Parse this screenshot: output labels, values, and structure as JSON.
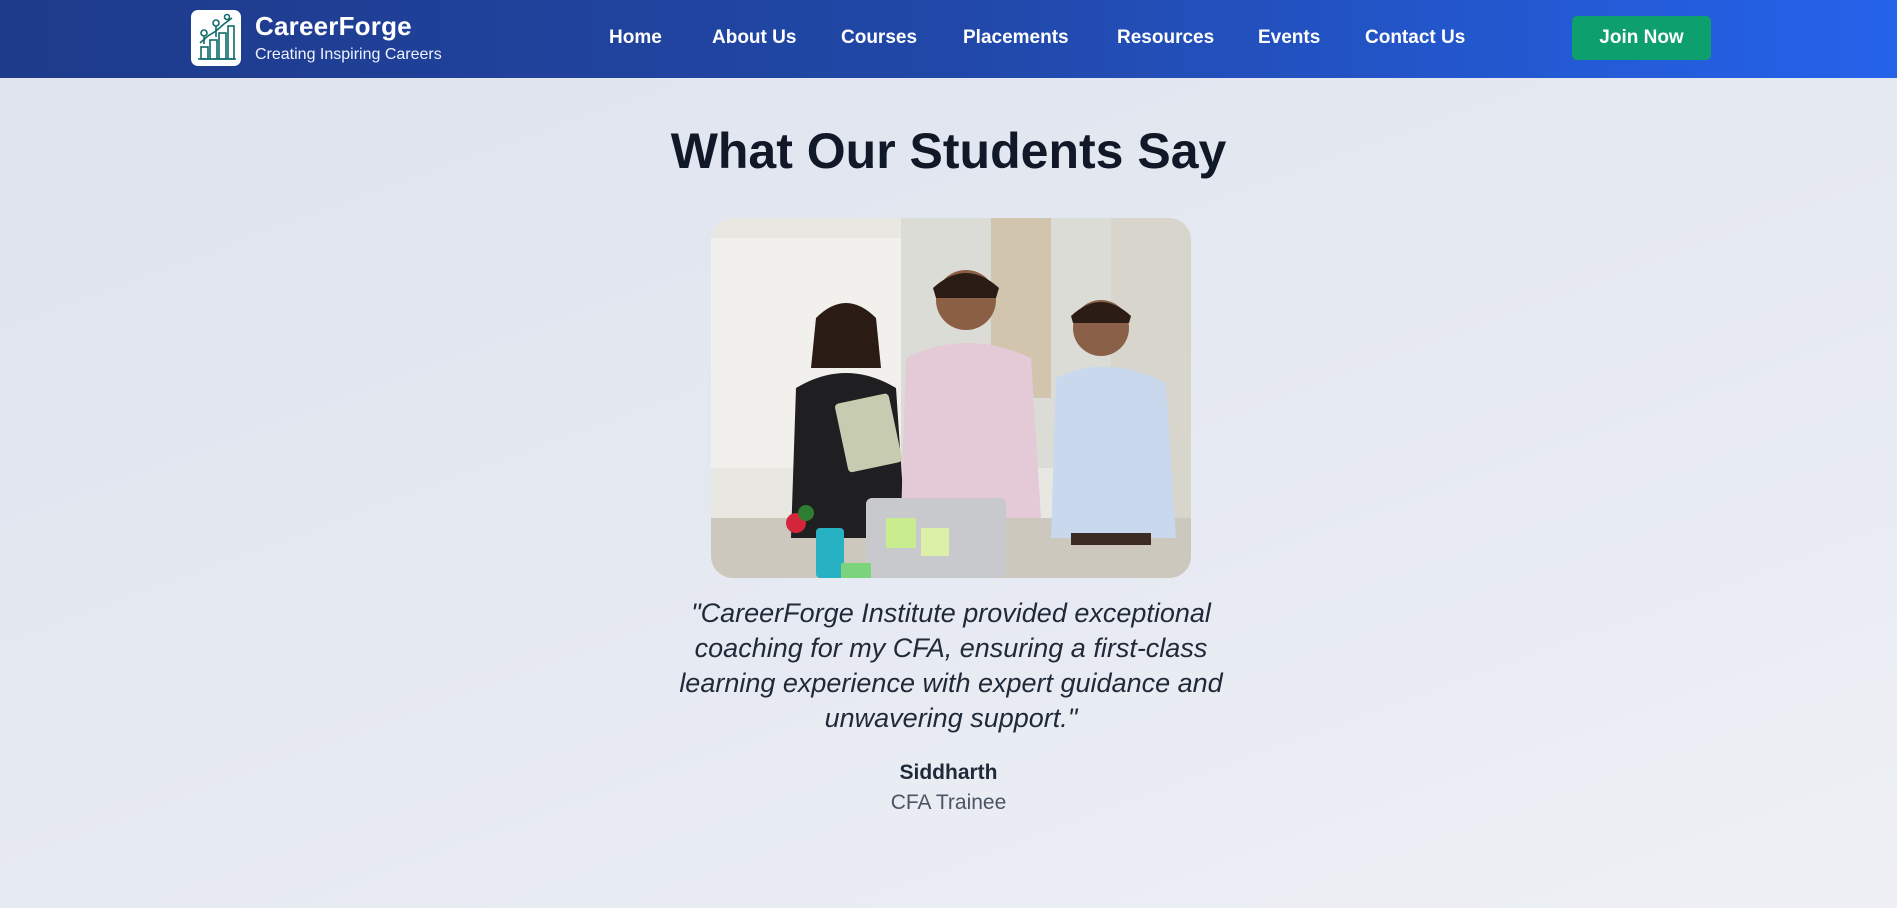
{
  "header": {
    "brand_name": "CareerForge",
    "brand_tagline": "Creating Inspiring Careers",
    "logo_icon": "growth-chart-icon",
    "nav_items": [
      {
        "label": "Home"
      },
      {
        "label": "About Us"
      },
      {
        "label": "Courses"
      },
      {
        "label": "Placements"
      },
      {
        "label": "Resources"
      },
      {
        "label": "Events"
      },
      {
        "label": "Contact Us"
      }
    ],
    "cta_label": "Join Now",
    "cta_color": "#0e9f6e",
    "gradient_start": "#1e3a8a",
    "gradient_end": "#2563eb"
  },
  "testimonials": {
    "title": "What Our Students Say",
    "photo_icon": "students-group-photo",
    "quote": "\"CareerForge Institute provided exceptional coaching for my CFA, ensuring a first-class learning experience with expert guidance and unwavering support.\"",
    "student_name": "Siddharth",
    "student_role": "CFA Trainee"
  }
}
